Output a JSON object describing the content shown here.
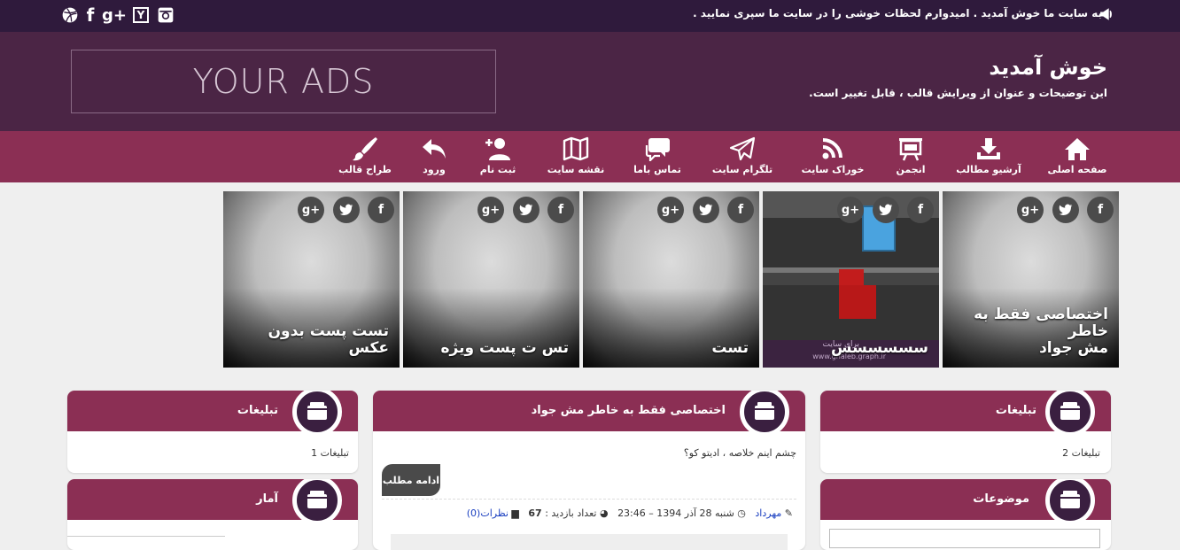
{
  "topbar": {
    "welcome_text": "به سایت ما خوش آمدید . امیدوارم لحظات خوشی را در سایت ما سپری نمایید .",
    "social": [
      {
        "icon": "instagram-icon"
      },
      {
        "icon": "y-combinator-icon",
        "label": "Y"
      },
      {
        "icon": "google-plus-icon",
        "label": "g+"
      },
      {
        "icon": "facebook-icon",
        "label": "f"
      },
      {
        "icon": "dribbble-icon"
      }
    ]
  },
  "header": {
    "ads_text": "YOUR ADS",
    "site_title": "خوش آمدید",
    "site_description": "این توضیحات و عنوان از ویرایش قالب ، قابل تغییر است."
  },
  "nav": {
    "items": [
      {
        "label": "صفحه اصلی",
        "icon": "home-icon"
      },
      {
        "label": "آرشیو مطالب",
        "icon": "download-icon"
      },
      {
        "label": "انجمن",
        "icon": "presentation-board-icon"
      },
      {
        "label": "خوراک سایت",
        "icon": "rss-icon"
      },
      {
        "label": "تلگرام سایت",
        "icon": "paper-plane-icon"
      },
      {
        "label": "تماس باما",
        "icon": "chat-bubbles-icon"
      },
      {
        "label": "نقشه سایت",
        "icon": "map-icon"
      },
      {
        "label": "ثبت نام",
        "icon": "user-add-icon"
      },
      {
        "label": "ورود",
        "icon": "reply-arrow-icon"
      },
      {
        "label": "طراح قالب",
        "icon": "paint-brush-icon"
      }
    ]
  },
  "slider": {
    "tiles": [
      {
        "caption_line1": "اختصاصی فقط به خاطر",
        "caption_line2": "مش جواد"
      },
      {
        "caption_line1": "سسسسسس",
        "caption_line2": ""
      },
      {
        "caption_line1": "تست",
        "caption_line2": ""
      },
      {
        "caption_line1": "تس ت پست ویژه",
        "caption_line2": ""
      },
      {
        "caption_line1": "تست پست بدون عکس",
        "caption_line2": ""
      }
    ],
    "share_icons": {
      "facebook": "f",
      "twitter": "twitter-icon",
      "google_plus": "g+"
    },
    "photo_texts": {
      "t1": "برای سایت",
      "t2": "www.ghaleb.graph.ir"
    }
  },
  "right_col": {
    "ads_widget": {
      "title": "تبلیغات",
      "body": "تبلیغات 2"
    },
    "topics_widget": {
      "title": "موضوعات"
    }
  },
  "center": {
    "post": {
      "title": "اختصاصی فقط به خاطر مش جواد",
      "summary": "چشم اینم خلاصه ، ادیتو کو؟",
      "read_more": "ادامه مطلب",
      "author": "مهرداد",
      "date": "شنبه 28 آذر 1394 – 23:46",
      "views_label": "تعداد بازدید :",
      "views_value": "67",
      "comments": "نظرات(0)"
    }
  },
  "left_col": {
    "ads_widget": {
      "title": "تبلیغات",
      "body": "تبلیغات 1"
    },
    "stats_widget": {
      "title": "آمار"
    }
  }
}
